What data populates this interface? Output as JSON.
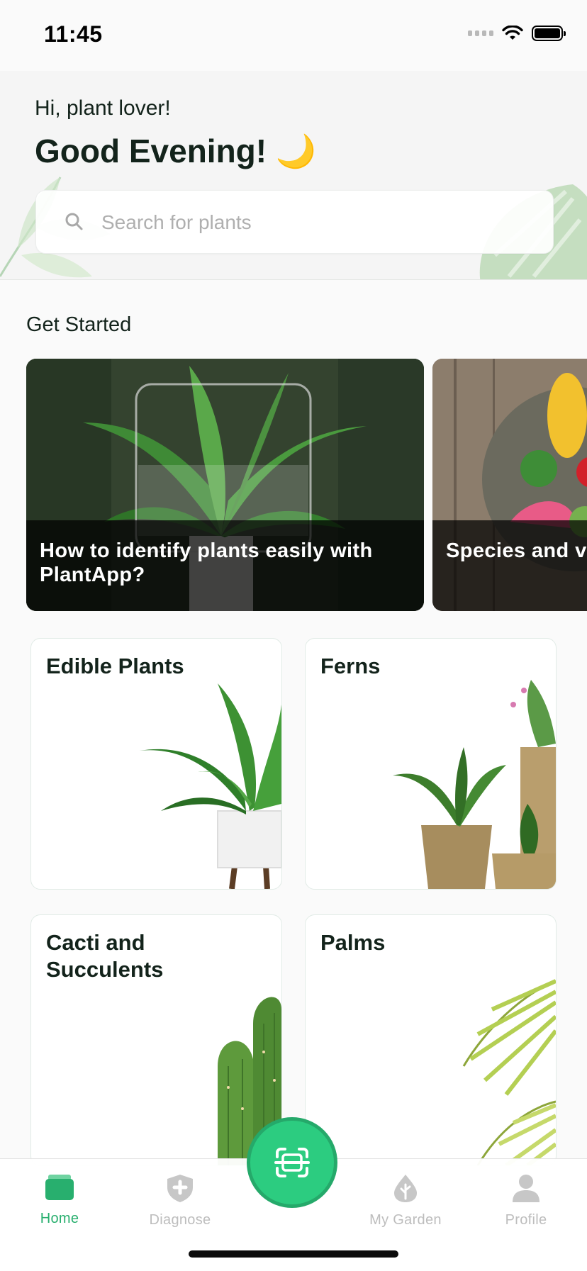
{
  "status_bar": {
    "time": "11:45"
  },
  "header": {
    "greeting": "Hi, plant lover!",
    "headline": "Good Evening! 🌙"
  },
  "search": {
    "placeholder": "Search for plants"
  },
  "get_started": {
    "title": "Get Started",
    "cards": [
      {
        "text": "How to identify plants easily with PlantApp?"
      },
      {
        "text": "Species and varieties: the difference"
      }
    ]
  },
  "categories": [
    {
      "label": "Edible Plants"
    },
    {
      "label": "Ferns"
    },
    {
      "label": "Cacti and Succulents"
    },
    {
      "label": "Palms"
    }
  ],
  "tabs": [
    {
      "label": "Home",
      "icon": "home-icon",
      "active": true
    },
    {
      "label": "Diagnose",
      "icon": "shield-plus-icon",
      "active": false
    },
    {
      "label": "My Garden",
      "icon": "leaf-drop-icon",
      "active": false
    },
    {
      "label": "Profile",
      "icon": "person-icon",
      "active": false
    }
  ],
  "colors": {
    "accent": "#28af6e",
    "scan_button": "#2ccc80",
    "text": "#13231b",
    "inactive": "#bdbdbd"
  }
}
